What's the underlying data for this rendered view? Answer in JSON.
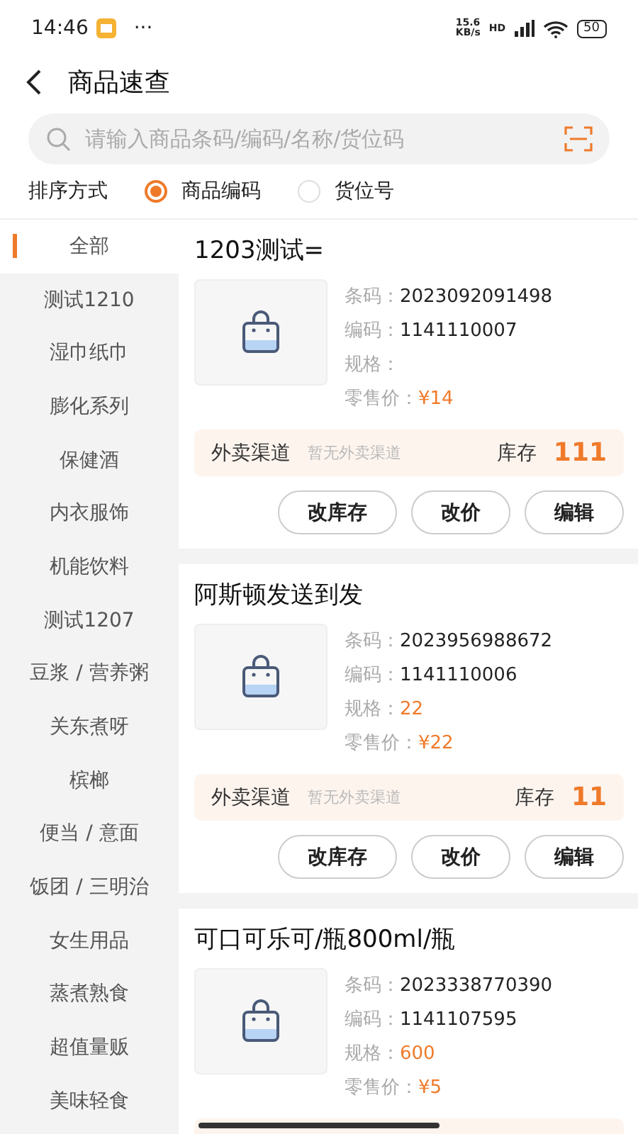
{
  "status_bar": {
    "time": "14:46",
    "more": "···",
    "speed": "15.6",
    "speed_unit": "KB/s",
    "hd": "HD",
    "battery": "50"
  },
  "header": {
    "title": "商品速查"
  },
  "search": {
    "placeholder": "请输入商品条码/编码/名称/货位码"
  },
  "sort": {
    "label": "排序方式",
    "options": [
      {
        "label": "商品编码",
        "selected": true
      },
      {
        "label": "货位号",
        "selected": false
      }
    ]
  },
  "categories": [
    {
      "label": "全部",
      "selected": true
    },
    {
      "label": "测试1210",
      "selected": false
    },
    {
      "label": "湿巾纸巾",
      "selected": false
    },
    {
      "label": "膨化系列",
      "selected": false
    },
    {
      "label": "保健酒",
      "selected": false
    },
    {
      "label": "内衣服饰",
      "selected": false
    },
    {
      "label": "机能饮料",
      "selected": false
    },
    {
      "label": "测试1207",
      "selected": false
    },
    {
      "label": "豆浆 / 营养粥",
      "selected": false
    },
    {
      "label": "关东煮呀",
      "selected": false
    },
    {
      "label": "槟榔",
      "selected": false
    },
    {
      "label": "便当 / 意面",
      "selected": false
    },
    {
      "label": "饭团 / 三明治",
      "selected": false
    },
    {
      "label": "女生用品",
      "selected": false
    },
    {
      "label": "蒸煮熟食",
      "selected": false
    },
    {
      "label": "超值量贩",
      "selected": false
    },
    {
      "label": "美味轻食",
      "selected": false
    }
  ],
  "products": [
    {
      "name": "1203测试=",
      "barcode_label": "条码：",
      "barcode": "2023092091498",
      "code_label": "编码：",
      "code": "1141110007",
      "spec_label": "规格：",
      "price_label": "零售价：",
      "price": "¥14",
      "channel_label": "外卖渠道",
      "channel_value": "暂无外卖渠道",
      "stock_label": "库存",
      "stock": "111",
      "buttons": [
        "改库存",
        "改价",
        "编辑"
      ]
    },
    {
      "name": "阿斯顿发送到发",
      "barcode_label": "条码：",
      "barcode": "2023956988672",
      "code_label": "编码：",
      "code": "1141110006",
      "spec_label": "规格：",
      "spec": "22",
      "price_label": "零售价：",
      "price": "¥22",
      "channel_label": "外卖渠道",
      "channel_value": "暂无外卖渠道",
      "stock_label": "库存",
      "stock": "11",
      "buttons": [
        "改库存",
        "改价",
        "编辑"
      ]
    },
    {
      "name": "可口可乐可/瓶800ml/瓶",
      "barcode_label": "条码：",
      "barcode": "2023338770390",
      "code_label": "编码：",
      "code": "1141107595",
      "spec_label": "规格：",
      "spec": "600",
      "price_label": "零售价：",
      "price": "¥5"
    }
  ]
}
